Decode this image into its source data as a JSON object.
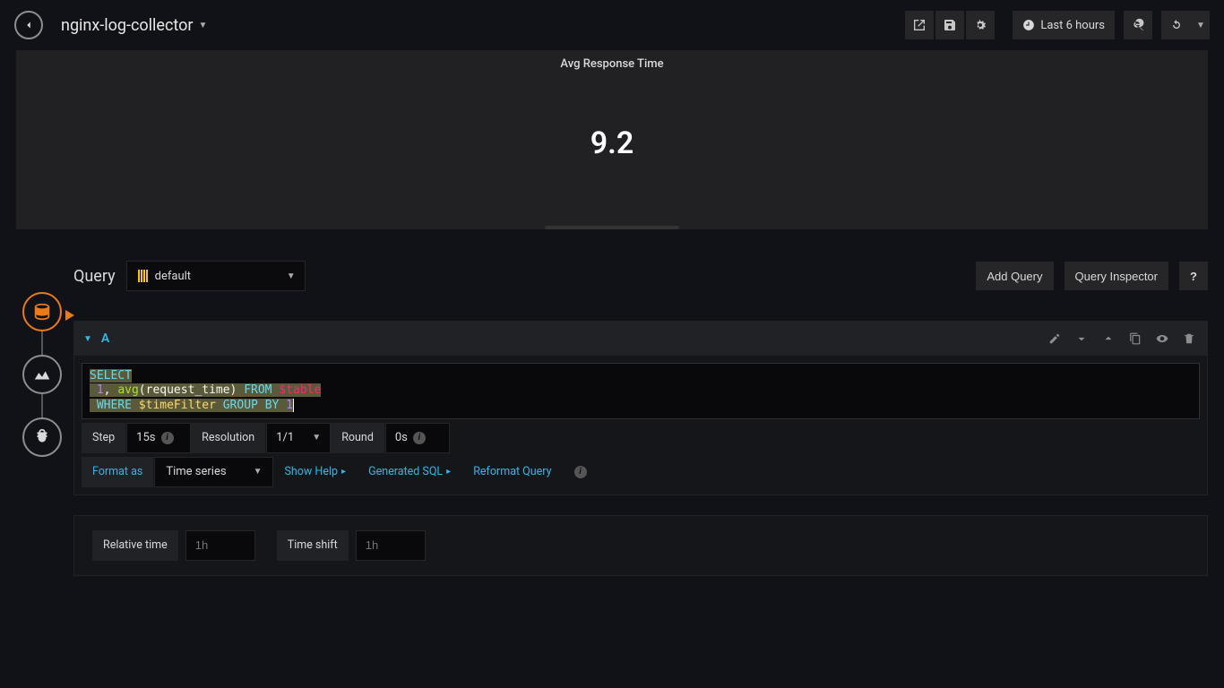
{
  "header": {
    "dashboard_title": "nginx-log-collector",
    "time_range_label": "Last 6 hours"
  },
  "panel": {
    "title": "Avg Response Time",
    "value": "9.2"
  },
  "query_section": {
    "title": "Query",
    "datasource": "default",
    "add_query_btn": "Add Query",
    "inspector_btn": "Query Inspector",
    "help_btn": "?"
  },
  "query_a": {
    "letter": "A",
    "sql_tokens": {
      "select": "SELECT",
      "one_a": "1",
      "comma": ",",
      "avg": "avg",
      "lp": "(",
      "rt": "request_time",
      "rp": ")",
      "from": "FROM",
      "table": "$table",
      "where": "WHERE",
      "tf": "$timeFilter",
      "group": "GROUP",
      "by": "BY",
      "one_b": "1"
    },
    "step_label": "Step",
    "step_value": "15s",
    "resolution_label": "Resolution",
    "resolution_value": "1/1",
    "round_label": "Round",
    "round_value": "0s",
    "format_as_label": "Format as",
    "format_as_value": "Time series",
    "show_help": "Show Help",
    "generated_sql": "Generated SQL",
    "reformat": "Reformat Query"
  },
  "time_overrides": {
    "relative_label": "Relative time",
    "relative_placeholder": "1h",
    "shift_label": "Time shift",
    "shift_placeholder": "1h"
  }
}
